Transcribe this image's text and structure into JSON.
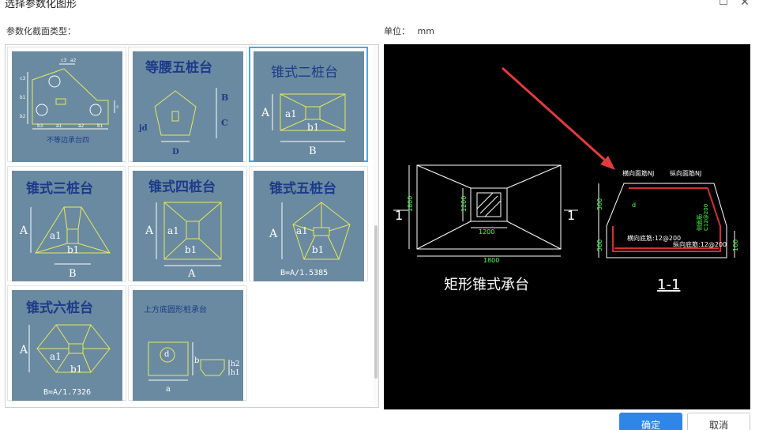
{
  "window": {
    "title": "选择参数化图形",
    "max_icon": "maximize-icon",
    "close_icon": "close-icon"
  },
  "left_label": "参数化截面类型：",
  "unit": {
    "label": "单位：",
    "value": "mm"
  },
  "thumbnails": [
    {
      "id": "irregular4",
      "caption": "不等边承台四",
      "labels": [
        "c3",
        "a2",
        "c3",
        "b1",
        "b2",
        "b3",
        "a1",
        "a2",
        "b1",
        "c"
      ]
    },
    {
      "id": "isosceles5",
      "caption": "等腰五桩台",
      "labels": [
        "B",
        "C",
        "jd",
        "D"
      ]
    },
    {
      "id": "cone2",
      "caption": "锥式二桩台",
      "labels": [
        "A",
        "a1",
        "b1",
        "B"
      ]
    },
    {
      "id": "cone3",
      "caption": "锥式三桩台",
      "labels": [
        "A",
        "a1",
        "b1",
        "B"
      ]
    },
    {
      "id": "cone4",
      "caption": "锥式四桩台",
      "labels": [
        "A",
        "a1",
        "b1",
        "A"
      ]
    },
    {
      "id": "cone5",
      "caption": "锥式五桩台",
      "labels": [
        "A",
        "a1",
        "b1"
      ],
      "formula": "B=A/1.5385"
    },
    {
      "id": "cone6",
      "caption": "锥式六桩台",
      "labels": [
        "A",
        "a1",
        "b1"
      ],
      "formula": "B=A/1.7326"
    },
    {
      "id": "round-square",
      "caption": "上方底圆形桩承台",
      "labels": [
        "d",
        "b",
        "a",
        "h2",
        "h1"
      ]
    }
  ],
  "selected_index": 2,
  "preview": {
    "plan_title": "矩形锥式承台",
    "section_title": "1-1",
    "section_mark": "1",
    "dim_plan_width": "1800",
    "dim_plan_height": "1800",
    "dim_inner_width": "1200",
    "dim_inner_height": "1200",
    "sec_top_bar": "横向面筋NJ",
    "sec_long_bar": "纵向面筋NJ",
    "sec_side_bar": "侧面筋",
    "sec_side_bar2": "C12@200",
    "sec_bottom_bar": "横向底筋:12@200",
    "sec_long_bottom": "纵向底筋:12@200",
    "sec_h1": "500",
    "sec_h2": "500",
    "sec_h3": "100",
    "sec_d": "d"
  },
  "buttons": {
    "ok": "确定",
    "cancel": "取消"
  },
  "colors": {
    "thumb_bg": "#6a8aa1",
    "selected_border": "#4aa6f0",
    "arrow": "#e23b3b",
    "primary": "#2f86e6"
  }
}
